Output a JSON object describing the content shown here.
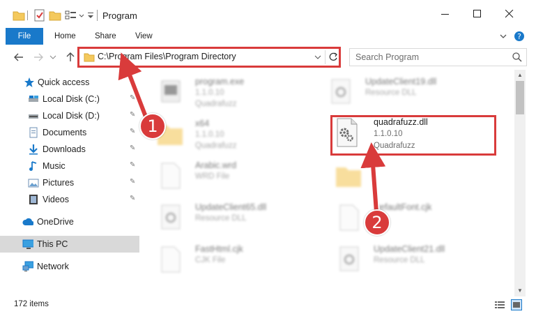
{
  "window": {
    "title": "Program",
    "minimize_glyph": "—",
    "maximize_glyph": "☐",
    "close_glyph": "✕"
  },
  "ribbon": {
    "tabs": [
      "File",
      "Home",
      "Share",
      "View"
    ],
    "expand_glyph": "⌄",
    "help_glyph": "?"
  },
  "address": {
    "path": "C:\\Program Files\\Program Directory",
    "search_placeholder": "Search Program"
  },
  "sidebar": {
    "items": [
      {
        "label": "Quick access",
        "icon": "star-icon"
      },
      {
        "label": "Local Disk (C:)",
        "icon": "drive-icon",
        "pinned": true
      },
      {
        "label": "Local Disk (D:)",
        "icon": "drive-icon",
        "pinned": true
      },
      {
        "label": "Documents",
        "icon": "documents-icon",
        "pinned": true
      },
      {
        "label": "Downloads",
        "icon": "download-icon",
        "pinned": true
      },
      {
        "label": "Music",
        "icon": "music-icon",
        "pinned": true
      },
      {
        "label": "Pictures",
        "icon": "pictures-icon",
        "pinned": true
      },
      {
        "label": "Videos",
        "icon": "videos-icon",
        "pinned": true
      },
      {
        "label": "OneDrive",
        "icon": "cloud-icon"
      },
      {
        "label": "This PC",
        "icon": "computer-icon",
        "selected": true
      },
      {
        "label": "Network",
        "icon": "network-icon"
      }
    ],
    "pin_glyph": "📌"
  },
  "files": [
    {
      "name": "program.exe",
      "version": "1.1.0.10",
      "type": "Quadrafuzz",
      "icon": "exe-icon",
      "blurred": true
    },
    {
      "name": "UpdateClient19.dll",
      "version": "Resource DLL",
      "type": "",
      "icon": "dll-icon",
      "blurred": true
    },
    {
      "name": "x64",
      "version": "1.1.0.10",
      "type": "Quadrafuzz",
      "icon": "folder-icon",
      "blurred": true
    },
    {
      "name": "quadrafuzz.dll",
      "version": "1.1.0.10",
      "type": "Quadrafuzz",
      "icon": "dll-icon",
      "blurred": false,
      "highlighted": true
    },
    {
      "name": "Arabic.wrd",
      "version": "WRD File",
      "type": "",
      "icon": "file-icon",
      "blurred": true
    },
    {
      "name": "",
      "version": "",
      "type": "",
      "icon": "folder-icon",
      "blurred": true
    },
    {
      "name": "UpdateClient65.dll",
      "version": "Resource DLL",
      "type": "",
      "icon": "dll-icon",
      "blurred": true
    },
    {
      "name": "DefaultFont.cjk",
      "version": "",
      "type": "",
      "icon": "file-icon",
      "blurred": true
    },
    {
      "name": "FastHtml.cjk",
      "version": "CJK File",
      "type": "",
      "icon": "file-icon",
      "blurred": true
    },
    {
      "name": "UpdateClient21.dll",
      "version": "Resource DLL",
      "type": "",
      "icon": "dll-icon",
      "blurred": true
    }
  ],
  "status": {
    "item_count": "172 items"
  },
  "annotations": {
    "step1": "1",
    "step2": "2",
    "color": "#d93b3b"
  },
  "colors": {
    "accent": "#1979ca",
    "highlight": "#d93b3b",
    "selected_bg": "#d9d9d9"
  }
}
